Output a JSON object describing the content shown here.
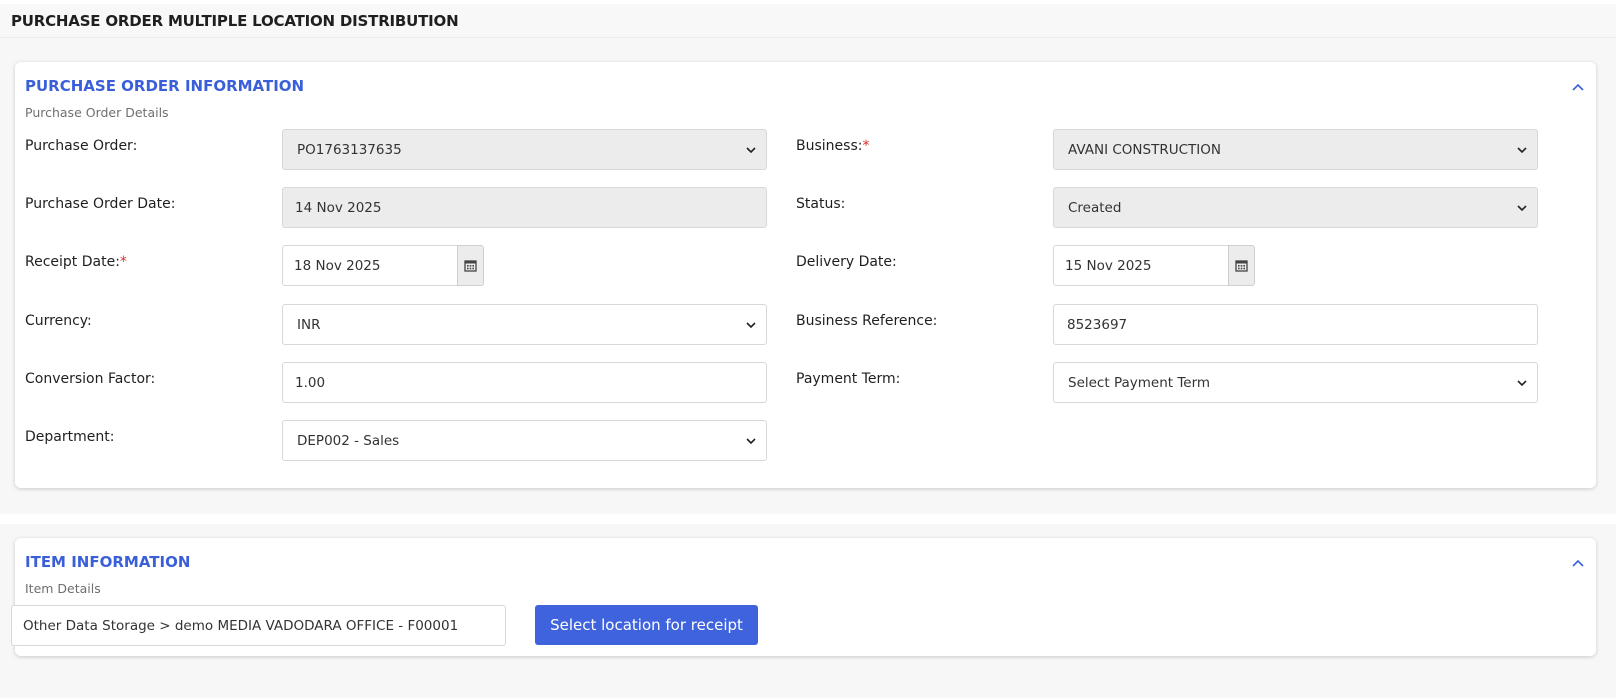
{
  "page": {
    "title": "PURCHASE ORDER MULTIPLE LOCATION DISTRIBUTION"
  },
  "po_section": {
    "title": "PURCHASE ORDER INFORMATION",
    "subtitle": "Purchase Order Details",
    "fields": {
      "purchase_order": {
        "label": "Purchase Order:",
        "value": "PO1763137635"
      },
      "business": {
        "label": "Business:",
        "required_mark": "*",
        "value": "AVANI CONSTRUCTION"
      },
      "po_date": {
        "label": "Purchase Order Date:",
        "value": "14 Nov 2025"
      },
      "status": {
        "label": "Status:",
        "value": "Created"
      },
      "receipt_date": {
        "label": "Receipt Date:",
        "required_mark": "*",
        "value": "18 Nov 2025"
      },
      "delivery_date": {
        "label": "Delivery Date:",
        "value": "15 Nov 2025"
      },
      "currency": {
        "label": "Currency:",
        "value": "INR"
      },
      "business_reference": {
        "label": "Business Reference:",
        "value": "8523697"
      },
      "conversion_factor": {
        "label": "Conversion Factor:",
        "value": "1.00"
      },
      "payment_term": {
        "label": "Payment Term:",
        "value": "Select Payment Term"
      },
      "department": {
        "label": "Department:",
        "value": "DEP002 - Sales"
      }
    }
  },
  "item_section": {
    "title": "ITEM INFORMATION",
    "subtitle": "Item Details",
    "location_value": "Other Data Storage > demo MEDIA VADODARA OFFICE - F00001",
    "select_button_label": "Select location for receipt"
  },
  "colors": {
    "accent": "#3a5fd8",
    "button": "#3e63dd",
    "required": "#e02b2b",
    "disabled_bg": "#ececec"
  },
  "icons": {
    "collapse": "chevron-up-icon",
    "dropdown": "chevron-down-icon",
    "calendar": "calendar-icon"
  }
}
